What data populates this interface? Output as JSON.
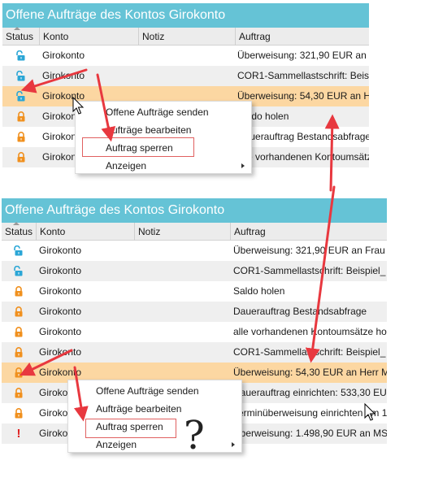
{
  "top_panel": {
    "title": "Offene Aufträge des Kontos Girokonto",
    "columns": [
      "Status",
      "Konto",
      "Notiz",
      "Auftrag"
    ],
    "rows": [
      {
        "icon": "unlock-icon",
        "konto": "Girokonto",
        "auftrag": "Überweisung: 321,90 EUR an"
      },
      {
        "icon": "unlock-icon",
        "konto": "Girokonto",
        "auftrag": "COR1-Sammellastschrift: Beis"
      },
      {
        "icon": "unlock-icon",
        "konto": "Girokonto",
        "auftrag": "Überweisung: 54,30 EUR an H"
      },
      {
        "icon": "lock-icon",
        "konto": "Girokonto",
        "auftrag": "Saldo holen"
      },
      {
        "icon": "lock-icon",
        "konto": "Girokonto",
        "auftrag": "Dauerauftrag Bestandsabfrage"
      },
      {
        "icon": "lock-icon",
        "konto": "Girokonto",
        "auftrag": "alle vorhandenen Kontoumsätze"
      }
    ],
    "context_menu": [
      "Offene Aufträge senden",
      "Aufträge bearbeiten",
      "Auftrag sperren",
      "Anzeigen"
    ]
  },
  "bottom_panel": {
    "title": "Offene Aufträge des Kontos Girokonto",
    "columns": [
      "Status",
      "Konto",
      "Notiz",
      "Auftrag"
    ],
    "rows": [
      {
        "icon": "unlock-icon",
        "konto": "Girokonto",
        "auftrag": "Überweisung: 321,90 EUR an Frau"
      },
      {
        "icon": "unlock-icon",
        "konto": "Girokonto",
        "auftrag": "COR1-Sammellastschrift: Beispiel_"
      },
      {
        "icon": "lock-icon",
        "konto": "Girokonto",
        "auftrag": "Saldo holen"
      },
      {
        "icon": "lock-icon",
        "konto": "Girokonto",
        "auftrag": "Dauerauftrag Bestandsabfrage"
      },
      {
        "icon": "lock-icon",
        "konto": "Girokonto",
        "auftrag": "alle vorhandenen Kontoumsätze ho"
      },
      {
        "icon": "lock-icon",
        "konto": "Girokonto",
        "auftrag": "COR1-Sammellastschrift: Beispiel_"
      },
      {
        "icon": "lock-icon",
        "konto": "Girokonto",
        "auftrag": "Überweisung: 54,30 EUR an Herr M"
      },
      {
        "icon": "lock-icon",
        "konto": "Girokonto",
        "auftrag": "Dauerauftrag einrichten: 533,30 EU"
      },
      {
        "icon": "lock-icon",
        "konto": "Girokonto",
        "auftrag": "Terminüberweisung einrichten am 1"
      },
      {
        "icon": "exclamation-icon",
        "konto": "Girokonto",
        "auftrag": "Überweisung: 1.498,90 EUR an MS"
      }
    ],
    "context_menu": [
      "Offene Aufträge senden",
      "Aufträge bearbeiten",
      "Auftrag sperren",
      "Anzeigen"
    ]
  },
  "annotation": {
    "question_mark": "?"
  },
  "colors": {
    "title_bar": "#65c3d6",
    "selected_row": "#fcd7a2",
    "unlock_icon": "#2aa6d6",
    "lock_icon": "#f0901e",
    "exclamation": "#e02020",
    "arrow": "#e8383f"
  }
}
